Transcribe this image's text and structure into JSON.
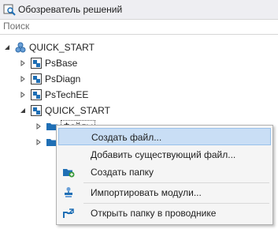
{
  "panel": {
    "title": "Обозреватель решений"
  },
  "search": {
    "placeholder": "Поиск"
  },
  "tree": {
    "root": "QUICK_START",
    "items": [
      {
        "label": "PsBase"
      },
      {
        "label": "PsDiagn"
      },
      {
        "label": "PsTechEE"
      },
      {
        "label": "QUICK_START"
      },
      {
        "label": "Файлы"
      }
    ]
  },
  "context_menu": {
    "items": [
      {
        "label": "Создать файл...",
        "icon": "new-file-icon"
      },
      {
        "label": "Добавить существующий файл...",
        "icon": "add-existing-file-icon"
      },
      {
        "label": "Создать папку",
        "icon": "new-folder-icon"
      },
      {
        "label": "Импортировать модули...",
        "icon": "import-icon"
      },
      {
        "label": "Открыть папку в проводнике",
        "icon": "open-in-explorer-icon"
      }
    ]
  },
  "colors": {
    "highlight": "#c9def5",
    "highlight_border": "#99c1ea",
    "accent": "#1f6fb5"
  }
}
